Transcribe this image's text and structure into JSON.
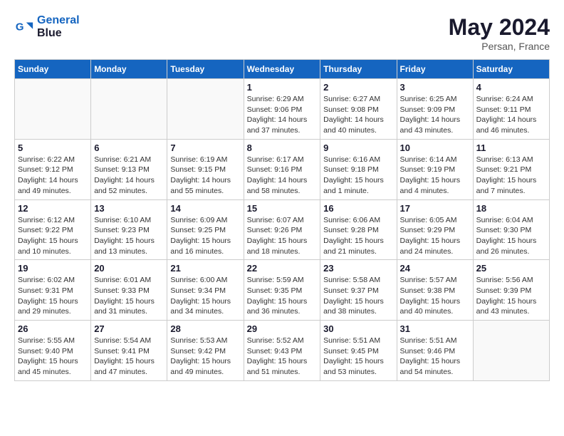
{
  "header": {
    "logo_line1": "General",
    "logo_line2": "Blue",
    "month_year": "May 2024",
    "location": "Persan, France"
  },
  "weekdays": [
    "Sunday",
    "Monday",
    "Tuesday",
    "Wednesday",
    "Thursday",
    "Friday",
    "Saturday"
  ],
  "weeks": [
    [
      {
        "day": "",
        "info": ""
      },
      {
        "day": "",
        "info": ""
      },
      {
        "day": "",
        "info": ""
      },
      {
        "day": "1",
        "info": "Sunrise: 6:29 AM\nSunset: 9:06 PM\nDaylight: 14 hours\nand 37 minutes."
      },
      {
        "day": "2",
        "info": "Sunrise: 6:27 AM\nSunset: 9:08 PM\nDaylight: 14 hours\nand 40 minutes."
      },
      {
        "day": "3",
        "info": "Sunrise: 6:25 AM\nSunset: 9:09 PM\nDaylight: 14 hours\nand 43 minutes."
      },
      {
        "day": "4",
        "info": "Sunrise: 6:24 AM\nSunset: 9:11 PM\nDaylight: 14 hours\nand 46 minutes."
      }
    ],
    [
      {
        "day": "5",
        "info": "Sunrise: 6:22 AM\nSunset: 9:12 PM\nDaylight: 14 hours\nand 49 minutes."
      },
      {
        "day": "6",
        "info": "Sunrise: 6:21 AM\nSunset: 9:13 PM\nDaylight: 14 hours\nand 52 minutes."
      },
      {
        "day": "7",
        "info": "Sunrise: 6:19 AM\nSunset: 9:15 PM\nDaylight: 14 hours\nand 55 minutes."
      },
      {
        "day": "8",
        "info": "Sunrise: 6:17 AM\nSunset: 9:16 PM\nDaylight: 14 hours\nand 58 minutes."
      },
      {
        "day": "9",
        "info": "Sunrise: 6:16 AM\nSunset: 9:18 PM\nDaylight: 15 hours\nand 1 minute."
      },
      {
        "day": "10",
        "info": "Sunrise: 6:14 AM\nSunset: 9:19 PM\nDaylight: 15 hours\nand 4 minutes."
      },
      {
        "day": "11",
        "info": "Sunrise: 6:13 AM\nSunset: 9:21 PM\nDaylight: 15 hours\nand 7 minutes."
      }
    ],
    [
      {
        "day": "12",
        "info": "Sunrise: 6:12 AM\nSunset: 9:22 PM\nDaylight: 15 hours\nand 10 minutes."
      },
      {
        "day": "13",
        "info": "Sunrise: 6:10 AM\nSunset: 9:23 PM\nDaylight: 15 hours\nand 13 minutes."
      },
      {
        "day": "14",
        "info": "Sunrise: 6:09 AM\nSunset: 9:25 PM\nDaylight: 15 hours\nand 16 minutes."
      },
      {
        "day": "15",
        "info": "Sunrise: 6:07 AM\nSunset: 9:26 PM\nDaylight: 15 hours\nand 18 minutes."
      },
      {
        "day": "16",
        "info": "Sunrise: 6:06 AM\nSunset: 9:28 PM\nDaylight: 15 hours\nand 21 minutes."
      },
      {
        "day": "17",
        "info": "Sunrise: 6:05 AM\nSunset: 9:29 PM\nDaylight: 15 hours\nand 24 minutes."
      },
      {
        "day": "18",
        "info": "Sunrise: 6:04 AM\nSunset: 9:30 PM\nDaylight: 15 hours\nand 26 minutes."
      }
    ],
    [
      {
        "day": "19",
        "info": "Sunrise: 6:02 AM\nSunset: 9:31 PM\nDaylight: 15 hours\nand 29 minutes."
      },
      {
        "day": "20",
        "info": "Sunrise: 6:01 AM\nSunset: 9:33 PM\nDaylight: 15 hours\nand 31 minutes."
      },
      {
        "day": "21",
        "info": "Sunrise: 6:00 AM\nSunset: 9:34 PM\nDaylight: 15 hours\nand 34 minutes."
      },
      {
        "day": "22",
        "info": "Sunrise: 5:59 AM\nSunset: 9:35 PM\nDaylight: 15 hours\nand 36 minutes."
      },
      {
        "day": "23",
        "info": "Sunrise: 5:58 AM\nSunset: 9:37 PM\nDaylight: 15 hours\nand 38 minutes."
      },
      {
        "day": "24",
        "info": "Sunrise: 5:57 AM\nSunset: 9:38 PM\nDaylight: 15 hours\nand 40 minutes."
      },
      {
        "day": "25",
        "info": "Sunrise: 5:56 AM\nSunset: 9:39 PM\nDaylight: 15 hours\nand 43 minutes."
      }
    ],
    [
      {
        "day": "26",
        "info": "Sunrise: 5:55 AM\nSunset: 9:40 PM\nDaylight: 15 hours\nand 45 minutes."
      },
      {
        "day": "27",
        "info": "Sunrise: 5:54 AM\nSunset: 9:41 PM\nDaylight: 15 hours\nand 47 minutes."
      },
      {
        "day": "28",
        "info": "Sunrise: 5:53 AM\nSunset: 9:42 PM\nDaylight: 15 hours\nand 49 minutes."
      },
      {
        "day": "29",
        "info": "Sunrise: 5:52 AM\nSunset: 9:43 PM\nDaylight: 15 hours\nand 51 minutes."
      },
      {
        "day": "30",
        "info": "Sunrise: 5:51 AM\nSunset: 9:45 PM\nDaylight: 15 hours\nand 53 minutes."
      },
      {
        "day": "31",
        "info": "Sunrise: 5:51 AM\nSunset: 9:46 PM\nDaylight: 15 hours\nand 54 minutes."
      },
      {
        "day": "",
        "info": ""
      }
    ]
  ]
}
